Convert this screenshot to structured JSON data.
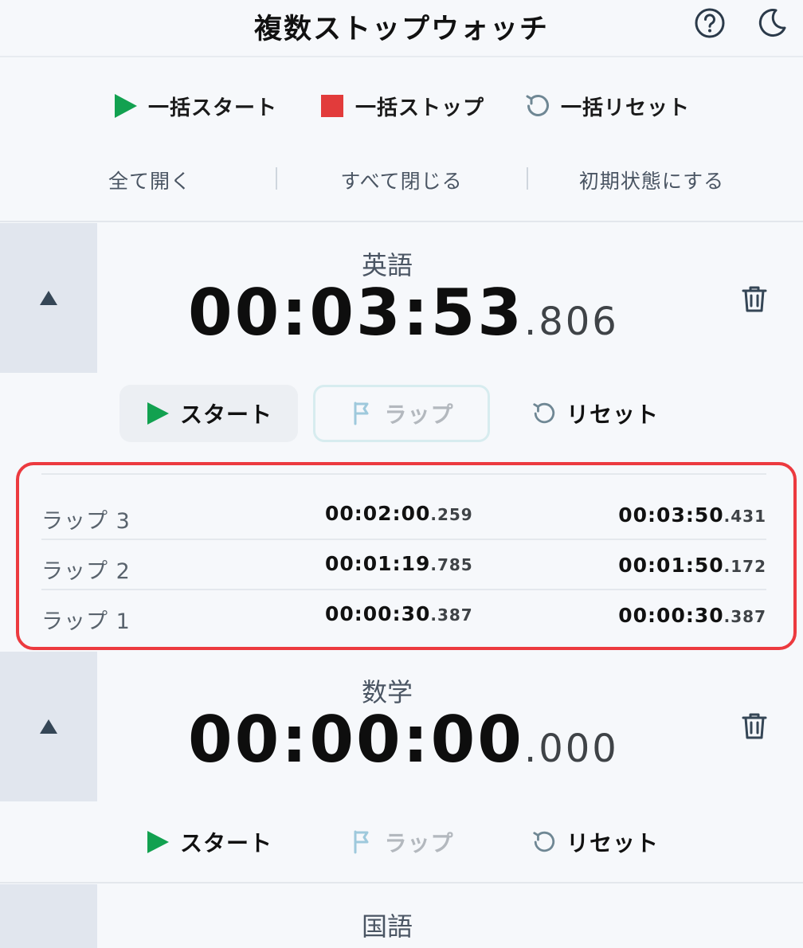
{
  "header": {
    "title": "複数ストップウォッチ",
    "icons": [
      "help-icon",
      "moon-icon"
    ]
  },
  "bulk_actions": {
    "start_label": "一括スタート",
    "stop_label": "一括ストップ",
    "reset_label": "一括リセット"
  },
  "controls": {
    "expand_all": "全て開く",
    "collapse_all": "すべて閉じる",
    "reset_state": "初期状態にする"
  },
  "colors": {
    "start_green": "#12a150",
    "stop_red": "#e23b3b",
    "highlight_red": "#ec3a3f",
    "lap_icon_blue": "#9ec9dc"
  },
  "stopwatches": [
    {
      "name": "英語",
      "time_main": "00:03:53",
      "time_ms": ".806",
      "start_label": "スタート",
      "lap_label": "ラップ",
      "reset_label": "リセット",
      "laps": [
        {
          "label": "ラップ 3",
          "split_main": "00:02:00",
          "split_ms": ".259",
          "total_main": "00:03:50",
          "total_ms": ".431"
        },
        {
          "label": "ラップ 2",
          "split_main": "00:01:19",
          "split_ms": ".785",
          "total_main": "00:01:50",
          "total_ms": ".172"
        },
        {
          "label": "ラップ 1",
          "split_main": "00:00:30",
          "split_ms": ".387",
          "total_main": "00:00:30",
          "total_ms": ".387"
        }
      ]
    },
    {
      "name": "数学",
      "time_main": "00:00:00",
      "time_ms": ".000",
      "start_label": "スタート",
      "lap_label": "ラップ",
      "reset_label": "リセット"
    },
    {
      "name": "国語"
    }
  ]
}
